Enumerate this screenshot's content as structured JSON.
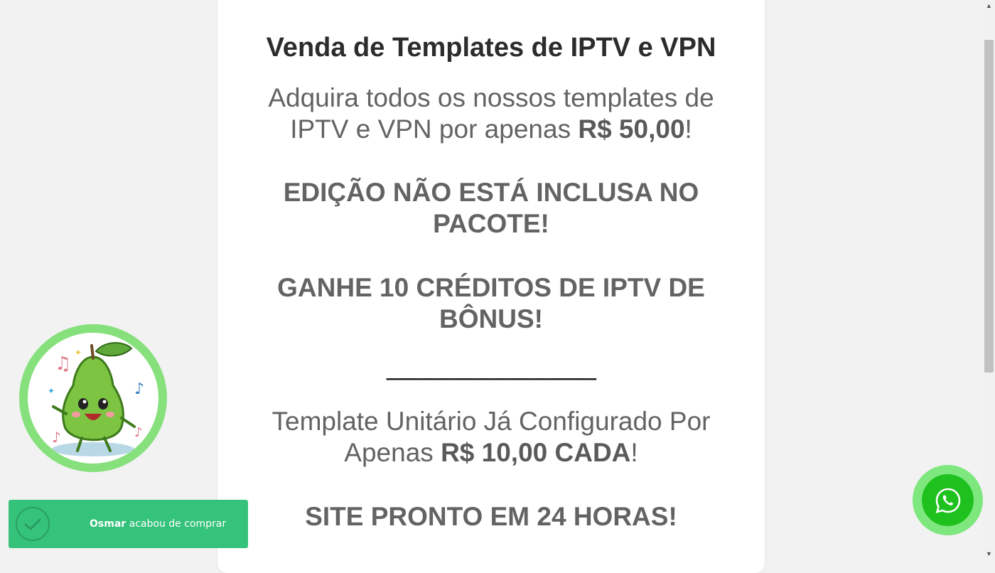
{
  "card": {
    "title": "Venda de Templates de IPTV e VPN",
    "p1_line1": "Adquira todos os nossos templates de",
    "p1_line2_pre": "IPTV e VPN por apenas ",
    "p1_price": "R$ 50,00",
    "p1_post": "!",
    "p2_line1": "EDIÇÃO NÃO ESTÁ INCLUSA NO",
    "p2_line2": "PACOTE!",
    "p3_line1": "GANHE 10 CRÉDITOS DE IPTV DE",
    "p3_line2": "BÔNUS!",
    "separator": "_______________",
    "p4_line1": "Template Unitário Já Configurado Por",
    "p4_line2_pre": "Apenas ",
    "p4_price": "R$ 10,00 CADA",
    "p4_post": "!",
    "p5": "SITE PRONTO EM 24 HORAS!"
  },
  "mascot": {
    "icon": "guava-mascot-icon"
  },
  "toast": {
    "name": "Osmar",
    "message": " acabou de comprar",
    "icon": "check-circle-icon",
    "color": "#35c27b"
  },
  "whatsapp": {
    "icon": "whatsapp-icon",
    "color": "#1fc11f"
  },
  "scrollbar": {
    "up_arrow": "▲",
    "down_arrow": "▼"
  }
}
